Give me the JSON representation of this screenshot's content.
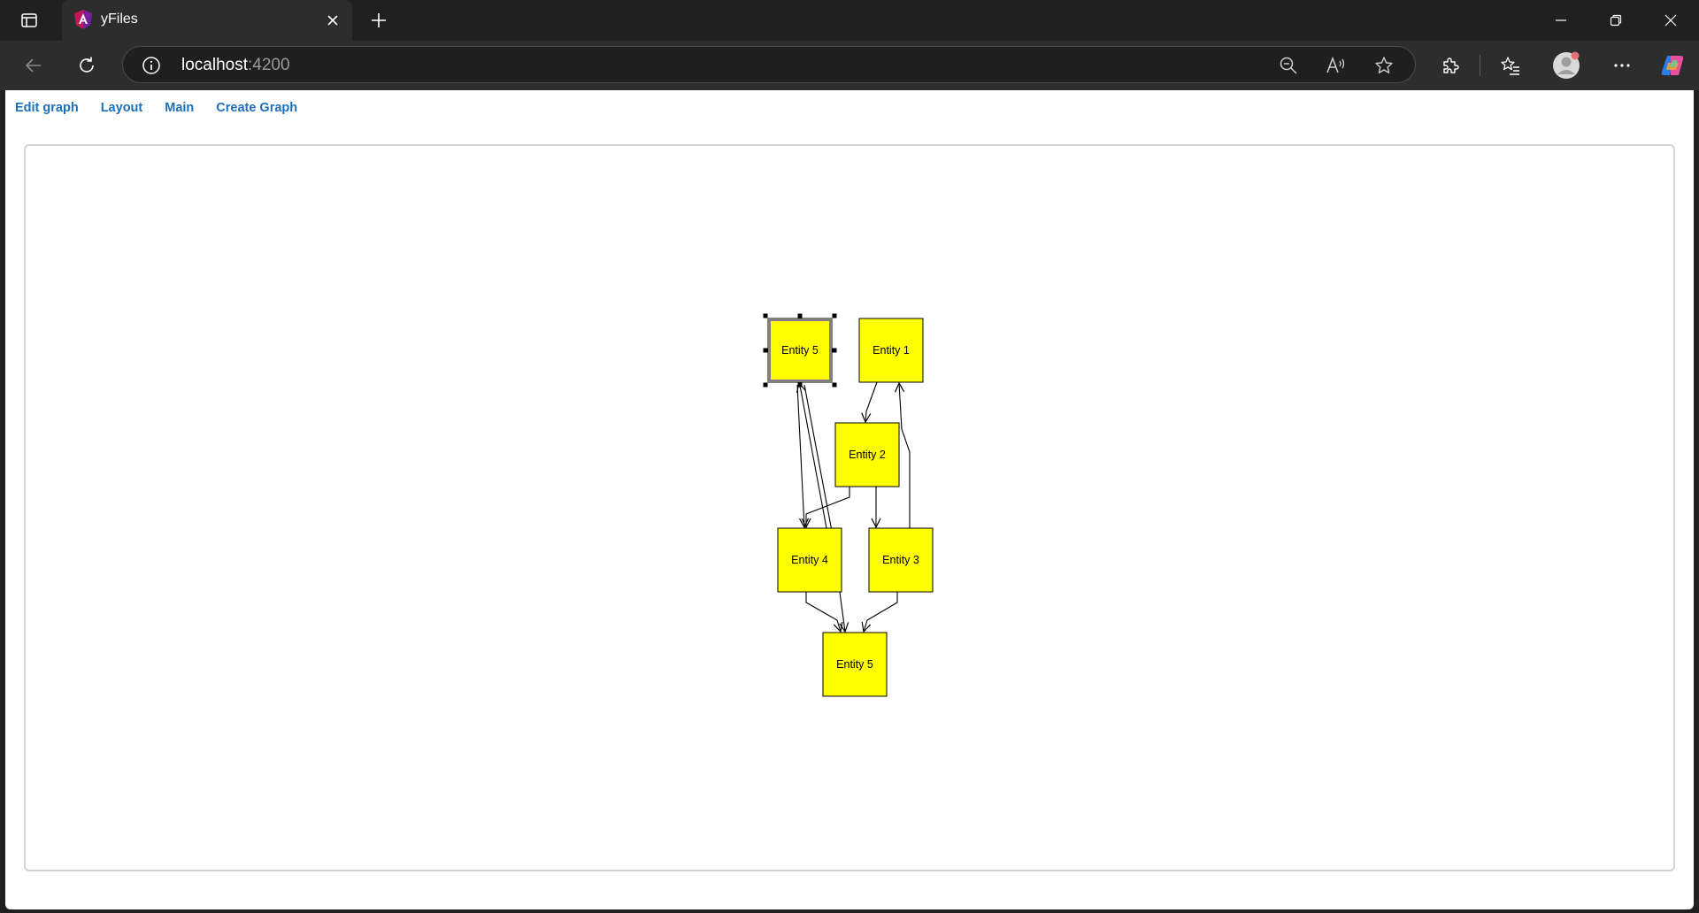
{
  "browser": {
    "tab": {
      "title": "yFiles"
    },
    "address": {
      "host": "localhost",
      "port": ":4200"
    },
    "colors": {
      "chrome_bg": "#202020",
      "toolbar_bg": "#2d2d2d",
      "link": "#1d6fb8",
      "node_fill": "#ffff00"
    }
  },
  "nav": {
    "links": [
      "Edit graph",
      "Layout",
      "Main",
      "Create Graph"
    ]
  },
  "graph": {
    "nodes": [
      {
        "id": "n5a",
        "label": "Entity 5",
        "selected": true
      },
      {
        "id": "n1",
        "label": "Entity 1",
        "selected": false
      },
      {
        "id": "n2",
        "label": "Entity 2",
        "selected": false
      },
      {
        "id": "n4",
        "label": "Entity 4",
        "selected": false
      },
      {
        "id": "n3",
        "label": "Entity 3",
        "selected": false
      },
      {
        "id": "n5b",
        "label": "Entity 5",
        "selected": false
      }
    ],
    "edges": [
      {
        "from": "n1",
        "to": "n2"
      },
      {
        "from": "n2",
        "to": "n4"
      },
      {
        "from": "n2",
        "to": "n3"
      },
      {
        "from": "n3",
        "to": "n1"
      },
      {
        "from": "n5a",
        "to": "n4"
      },
      {
        "from": "n4",
        "to": "n5a"
      },
      {
        "from": "n4",
        "to": "n5b"
      },
      {
        "from": "n3",
        "to": "n5b"
      },
      {
        "from": "n5a",
        "to": "n5b"
      }
    ]
  }
}
